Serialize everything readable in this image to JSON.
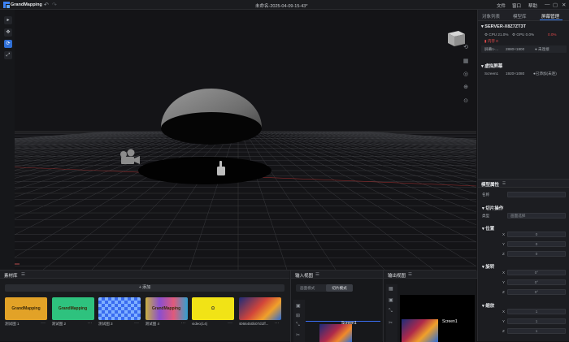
{
  "app": {
    "name": "GrandMapping",
    "doc_title": "未命名-2025-04-09-15-43*"
  },
  "menu": [
    "文件",
    "窗口",
    "帮助"
  ],
  "window_controls": [
    "—",
    "▢",
    "✕"
  ],
  "left_tools": [
    "▸",
    "✥",
    "⟳",
    "⤢"
  ],
  "viewport_tools": [
    "⟲",
    "▦",
    "◎",
    "⊕",
    "⊙"
  ],
  "right_tabs": [
    "对象列表",
    "模型库",
    "屏幕管理"
  ],
  "server": {
    "name": "SERVER-X8Z7ZT3T",
    "cpu_label": "CPU",
    "cpu": "21.0%",
    "gpu_label": "GPU",
    "gpu": "0.0%",
    "gpu_status": "0.0%",
    "mem_label": "内存",
    "mem": "0",
    "display_name": "屏幕1-...",
    "display_res": "2880×1800",
    "display_status": "● 未连接"
  },
  "virtual": {
    "title": "虚拟屏幕",
    "screen_name": "Screen1",
    "screen_res": "1920×1080",
    "screen_status": "●已添加(未连)"
  },
  "props": {
    "title": "模型属性",
    "name_label": "名称",
    "slice_title": "切片操作",
    "type_label": "类型",
    "type_value": "画面选择",
    "pos_title": "位置",
    "rot_title": "旋转",
    "scale_title": "缩放",
    "axes": [
      "X",
      "Y",
      "Z"
    ],
    "pos": [
      "0",
      "0",
      "0"
    ],
    "rot": [
      "0°",
      "0°",
      "0°"
    ],
    "scale": [
      "1",
      "1",
      "1"
    ]
  },
  "assets": {
    "title": "素材库",
    "add_label": "+ 添加",
    "items": [
      {
        "label": "GrandMapping",
        "caption": "测试图 1",
        "color": "#e2a227"
      },
      {
        "label": "GrandMapping",
        "caption": "测试图 2",
        "color": "#2ec27e"
      },
      {
        "label": "",
        "caption": "测试图 3",
        "color": "#3a6cf0"
      },
      {
        "label": "GrandMapping",
        "caption": "测试图 4",
        "color": "#8a4fd0"
      },
      {
        "label": "Ω",
        "caption": "video(14)",
        "color": "#f1e316"
      },
      {
        "label": "",
        "caption": "4066450b07d1ff...",
        "color": "#d2453a"
      }
    ]
  },
  "input": {
    "title": "输入视图",
    "mode1": "画面模式",
    "mode2": "切片模式",
    "screen": "Screen1"
  },
  "output": {
    "title": "输出视图",
    "screen": "Screen1"
  }
}
